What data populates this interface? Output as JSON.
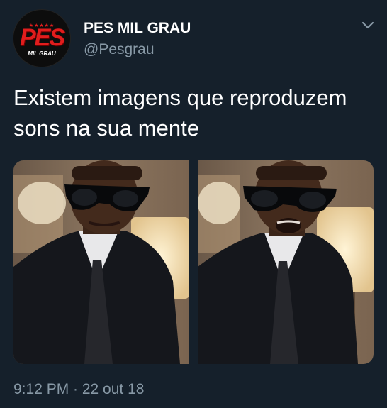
{
  "profile": {
    "display_name": "PES MIL GRAU",
    "handle": "@Pesgrau",
    "avatar": {
      "logo_text": "PES",
      "logo_subtext": "MIL GRAU",
      "logo_stars": "★★★★★",
      "logo_color": "#e21d1d"
    }
  },
  "menu": {
    "icon": "chevron-down-icon"
  },
  "tweet": {
    "text": "Existem imagens que reproduzem sons na sua mente",
    "timestamp": "9:12 PM · 22 out 18"
  },
  "theme": {
    "background": "#15202b",
    "primary_text": "#ffffff",
    "secondary_text": "#8899a6"
  },
  "media": [
    {
      "name": "photo-mouth-closed"
    },
    {
      "name": "photo-mouth-open"
    }
  ]
}
